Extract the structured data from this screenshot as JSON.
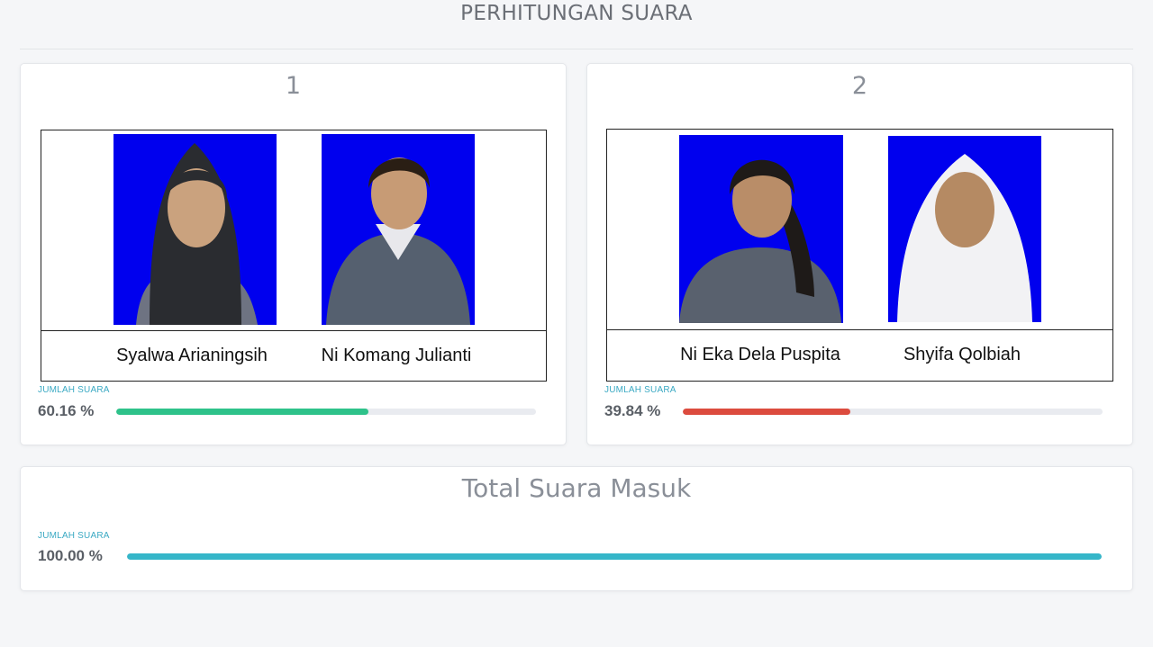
{
  "page": {
    "title": "PERHITUNGAN SUARA"
  },
  "candidates": [
    {
      "number": "1",
      "names": [
        "Syalwa Arianingsih",
        "Ni Komang Julianti"
      ],
      "vote_label": "JUMLAH SUARA",
      "percent_text": "60.16 %",
      "percent": 60.16,
      "bar_color": "#2ec28a"
    },
    {
      "number": "2",
      "names": [
        "Ni Eka Dela Puspita",
        "Shyifa Qolbiah"
      ],
      "vote_label": "JUMLAH SUARA",
      "percent_text": "39.84 %",
      "percent": 39.84,
      "bar_color": "#dc4b3e"
    }
  ],
  "total": {
    "title": "Total Suara Masuk",
    "vote_label": "JUMLAH SUARA",
    "percent_text": "100.00 %",
    "percent": 100,
    "bar_color": "#35b6c9"
  },
  "colors": {
    "photo_background": "#0000ee"
  }
}
